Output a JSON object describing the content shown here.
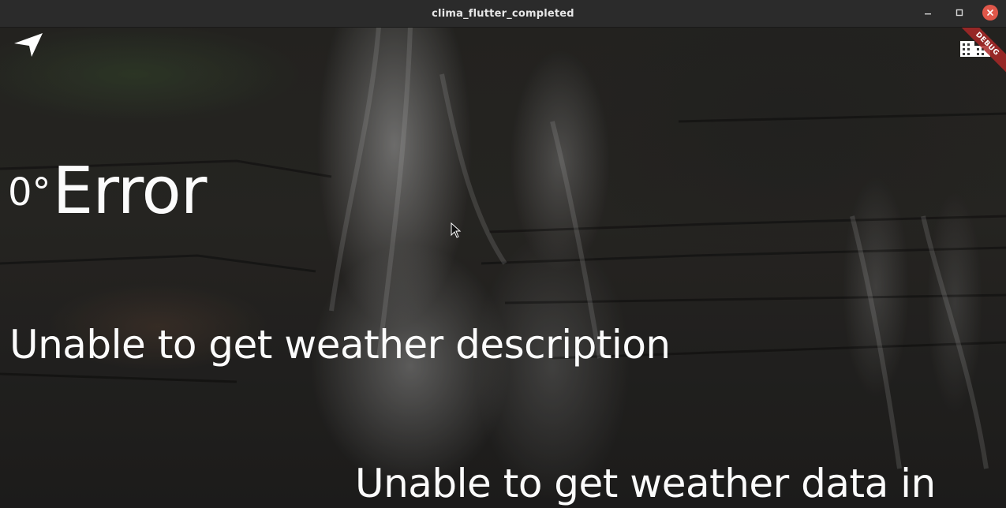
{
  "window": {
    "title": "clima_flutter_completed",
    "controls": {
      "minimize_icon": "minimize-icon",
      "maximize_icon": "maximize-icon",
      "close_icon": "close-icon",
      "close_color": "#e0574a"
    }
  },
  "app": {
    "location_icon": "navigation-arrow-icon",
    "city_icon": "city-buildings-icon",
    "debug_banner": "DEBUG",
    "weather": {
      "temperature": "0°",
      "condition": "Error",
      "description": "Unable to get weather description",
      "message": "Unable to get weather data in"
    }
  },
  "colors": {
    "text": "#fbfbfb",
    "titlebar": "#2b2b2b",
    "debug_banner": "#aa2828"
  }
}
